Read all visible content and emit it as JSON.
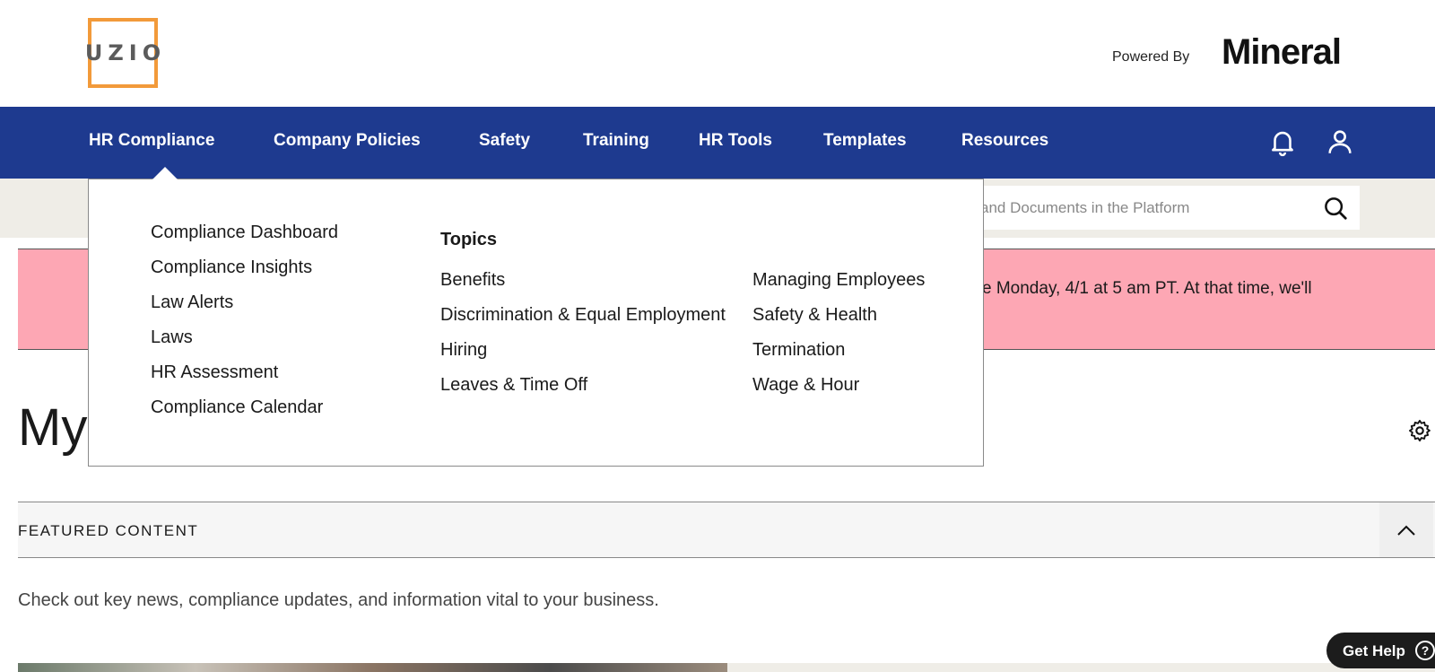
{
  "header": {
    "logo_text": "UZIO",
    "powered_by": "Powered By",
    "partner_brand": "Mineral"
  },
  "nav": {
    "items": [
      {
        "label": "HR Compliance"
      },
      {
        "label": "Company Policies"
      },
      {
        "label": "Safety"
      },
      {
        "label": "Training"
      },
      {
        "label": "HR Tools"
      },
      {
        "label": "Templates"
      },
      {
        "label": "Resources"
      }
    ],
    "icons": [
      "bell-icon",
      "user-icon"
    ]
  },
  "search": {
    "placeholder": "and Documents in the Platform"
  },
  "alert": {
    "text": "e Monday, 4/1 at 5 am PT. At that time, we'll"
  },
  "page": {
    "title": "My"
  },
  "featured": {
    "label": "FEATURED CONTENT",
    "description": "Check out key news, compliance updates, and information vital to your business."
  },
  "dropdown": {
    "left_links": [
      "Compliance Dashboard",
      "Compliance Insights",
      "Law Alerts",
      "Laws",
      "HR Assessment",
      "Compliance Calendar"
    ],
    "topics_heading": "Topics",
    "topics_col1": [
      "Benefits",
      "Discrimination & Equal Employment",
      "Hiring",
      "Leaves & Time Off"
    ],
    "topics_col2": [
      "Managing Employees",
      "Safety & Health",
      "Termination",
      "Wage & Hour"
    ]
  },
  "help": {
    "label": "Get Help",
    "icon_glyph": "?"
  },
  "colors": {
    "nav_bg": "#1e3a8f",
    "logo_orange": "#f29a3a",
    "alert_pink": "#fda7b4",
    "search_row_bg": "#efede7"
  }
}
